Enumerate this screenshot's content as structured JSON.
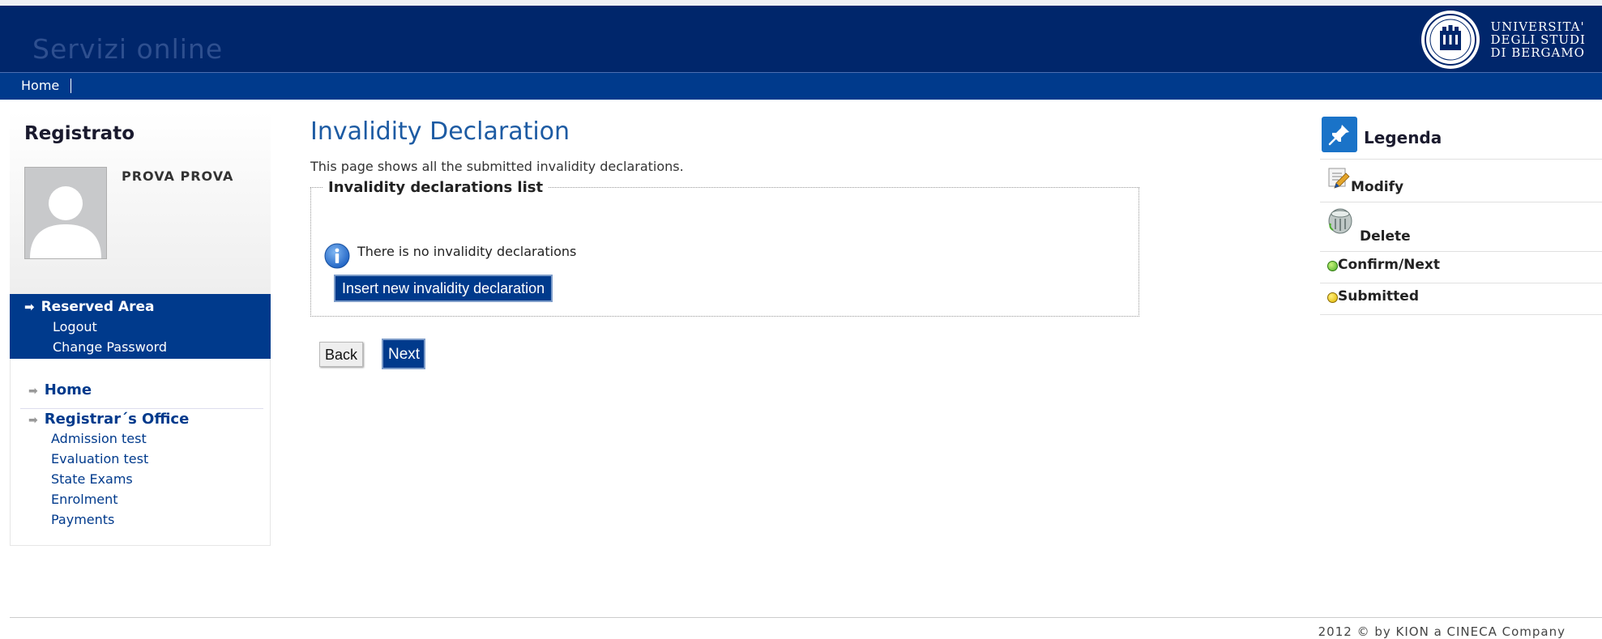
{
  "header": {
    "site_title": "Servizi online",
    "university_line1": "UNIVERSITA'",
    "university_line2": "DEGLI STUDI",
    "university_line3": "DI BERGAMO"
  },
  "navbar": {
    "home": "Home"
  },
  "sidebar": {
    "box_title": "Registrato",
    "user_name": "PROVA PROVA",
    "reserved_area": {
      "title": "Reserved Area",
      "links": [
        "Logout",
        "Change Password"
      ]
    },
    "menu": {
      "home": "Home",
      "registrar": "Registrar´s Office",
      "sub_items": [
        "Admission test",
        "Evaluation test",
        "State Exams",
        "Enrolment",
        "Payments"
      ]
    }
  },
  "main": {
    "title": "Invalidity Declaration",
    "description": "This page shows all the submitted invalidity declarations.",
    "list_legend": "Invalidity declarations list",
    "empty_message": "There is no invalidity declarations",
    "insert_button": "Insert new invalidity declaration",
    "back_button": "Back",
    "next_button": "Next"
  },
  "legend": {
    "title": "Legenda",
    "items": [
      {
        "label": "Modify",
        "icon": "pencil-doc-icon"
      },
      {
        "label": "Delete",
        "icon": "trash-icon"
      },
      {
        "label": "Confirm/Next",
        "icon": "green-dot-icon",
        "color": "#4caf2a"
      },
      {
        "label": "Submitted",
        "icon": "yellow-dot-icon",
        "color": "#e0b400"
      }
    ]
  },
  "footer": {
    "text": "2012 © by KION a CINECA Company"
  },
  "colors": {
    "header_bg": "#00266b",
    "nav_bg": "#003a8c",
    "accent": "#1d5ba3"
  }
}
